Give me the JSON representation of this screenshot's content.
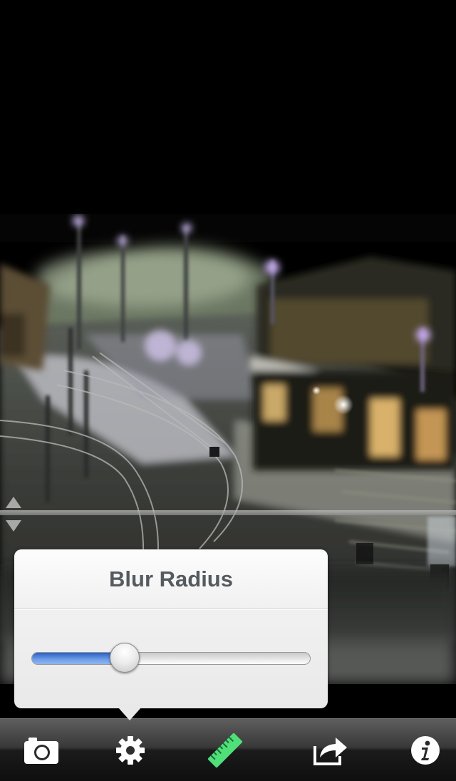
{
  "popover": {
    "title": "Blur Radius",
    "blur_radius_fraction": 0.33
  },
  "toolbar": {
    "buttons": [
      {
        "icon": "camera-icon"
      },
      {
        "icon": "gear-icon",
        "selected": true
      },
      {
        "icon": "ruler-icon",
        "color": "#4fe07a"
      },
      {
        "icon": "share-icon"
      },
      {
        "icon": "info-icon"
      }
    ]
  },
  "colors": {
    "slider_fill": "#4a7fd8",
    "toolbar": "#2a2a2a",
    "ruler_green": "#4fe07a"
  }
}
